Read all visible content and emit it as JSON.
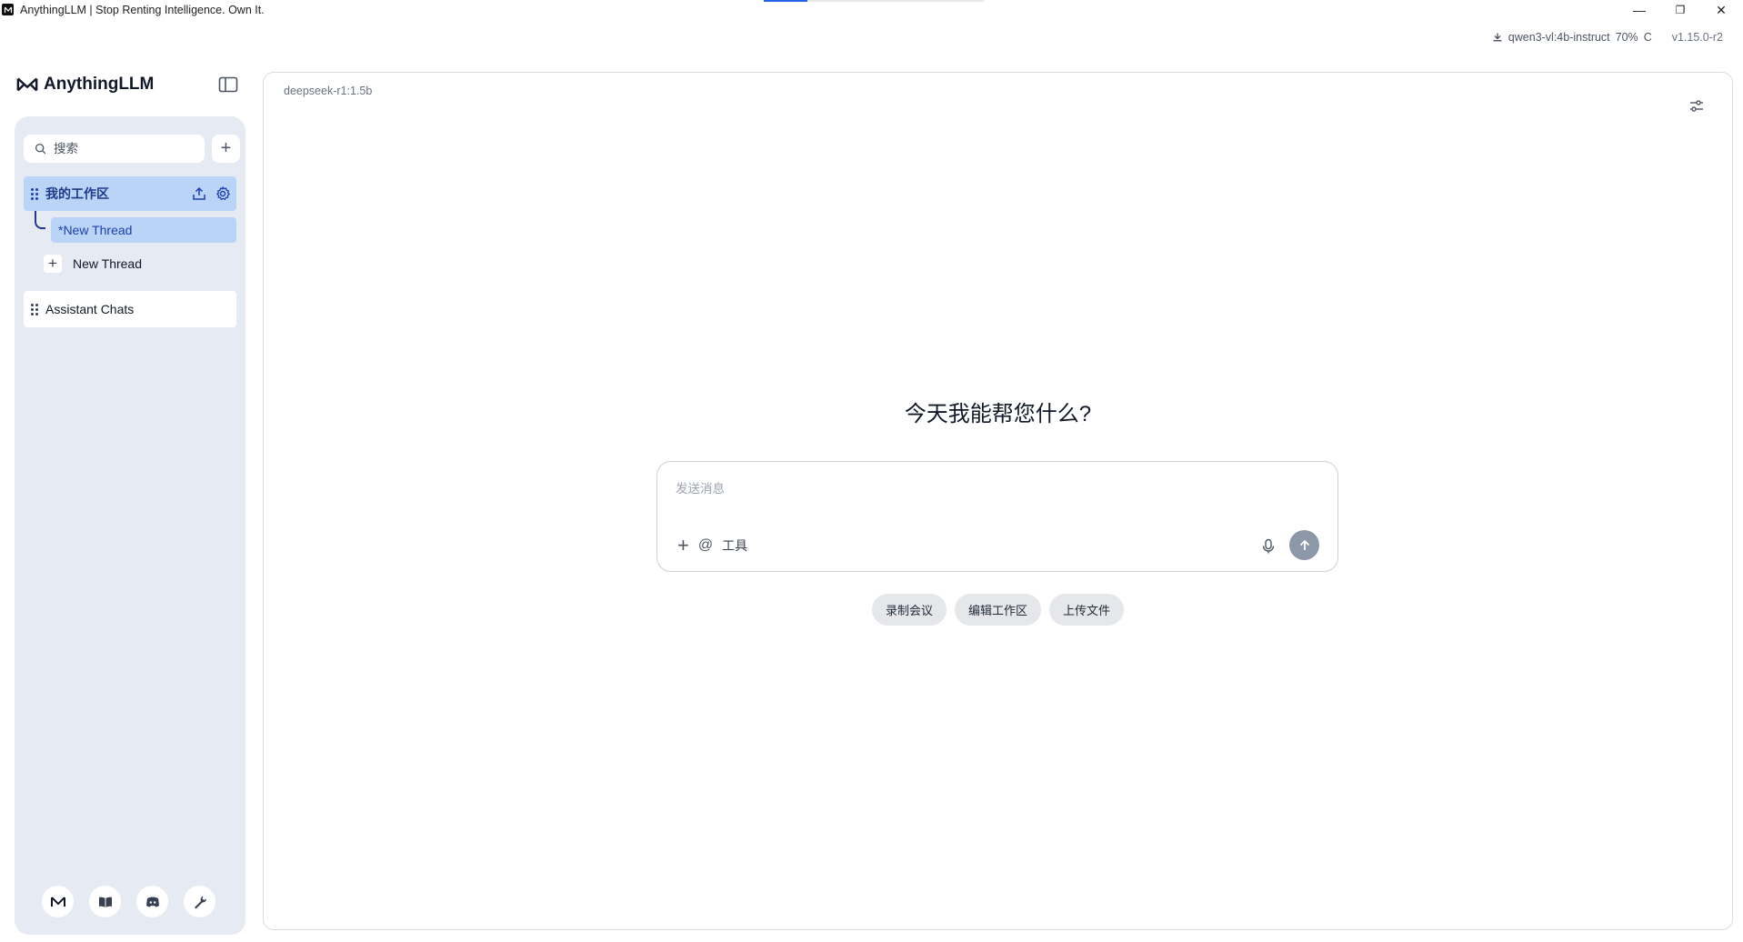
{
  "window": {
    "title": "AnythingLLM | Stop Renting Intelligence. Own It.",
    "minimize": "—",
    "restore": "❐",
    "close": "✕"
  },
  "status": {
    "download_model": "qwen3-vl:4b-instruct",
    "download_progress": "70%",
    "download_state": "C",
    "version": "v1.15.0-r2"
  },
  "brand": {
    "name": "AnythingLLM"
  },
  "sidebar": {
    "search_placeholder": "搜索",
    "add_label": "+",
    "workspaces": [
      {
        "name": "我的工作区",
        "active": true
      }
    ],
    "threads": [
      {
        "label": "*New Thread",
        "active": true
      }
    ],
    "new_thread_label": "New Thread",
    "assistant_item": "Assistant Chats"
  },
  "main": {
    "model": "deepseek-r1:1.5b",
    "greeting": "今天我能帮您什么?",
    "composer": {
      "placeholder": "发送消息",
      "plus": "+",
      "at": "@",
      "tools_label": "工具"
    },
    "suggestions": [
      "录制会议",
      "编辑工作区",
      "上传文件"
    ]
  },
  "colors": {
    "accent": "#2563eb",
    "sidebar_bg": "#e6ebf3",
    "active_item_bg": "#b9d4f6",
    "send_button": "#8c98a9"
  }
}
